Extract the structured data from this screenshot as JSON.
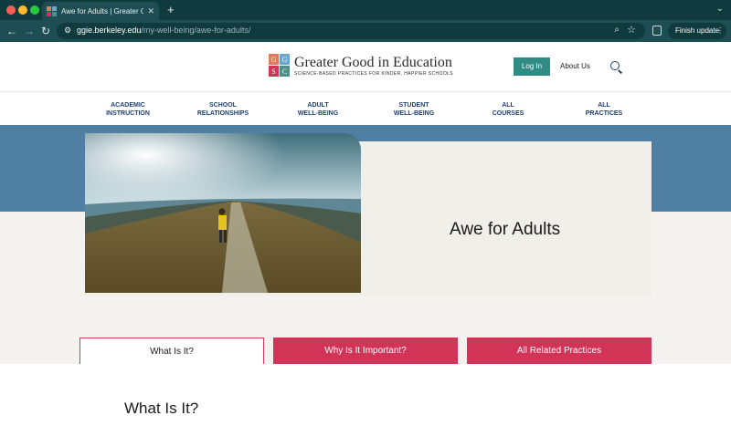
{
  "browser": {
    "tab_title": "Awe for Adults | Greater Good",
    "url_host": "ggie.berkeley.edu",
    "url_path": "/my-well-being/awe-for-adults/",
    "finish_update_label": "Finish update"
  },
  "site": {
    "logo_letters": [
      "G",
      "G",
      "S",
      "C"
    ],
    "logo_colors": [
      "#e07b5c",
      "#6aa7c9",
      "#d23457",
      "#4e8f8a"
    ],
    "name": "Greater Good in Education",
    "tagline": "SCIENCE-BASED PRACTICES FOR KINDER, HAPPIER SCHOOLS",
    "login_label": "Log In",
    "about_label": "About Us"
  },
  "nav": {
    "items": [
      {
        "line1": "ACADEMIC",
        "line2": "INSTRUCTION"
      },
      {
        "line1": "SCHOOL",
        "line2": "RELATIONSHIPS"
      },
      {
        "line1": "ADULT",
        "line2": "WELL-BEING"
      },
      {
        "line1": "STUDENT",
        "line2": "WELL-BEING"
      },
      {
        "line1": "ALL",
        "line2": "COURSES"
      },
      {
        "line1": "ALL",
        "line2": "PRACTICES"
      }
    ]
  },
  "hero": {
    "title": "Awe for Adults"
  },
  "tabs": [
    {
      "label": "What Is It?",
      "active": true
    },
    {
      "label": "Why Is It Important?",
      "active": false
    },
    {
      "label": "All Related Practices",
      "active": false
    }
  ],
  "content": {
    "section_title": "What Is It?"
  },
  "colors": {
    "browser_dark": "#0f3b3e",
    "browser_mid": "#1e4e53",
    "accent_teal": "#2f8b83",
    "hero_blue": "#4f7fa3",
    "tab_red": "#d23457",
    "nav_text": "#1f3f6e"
  }
}
